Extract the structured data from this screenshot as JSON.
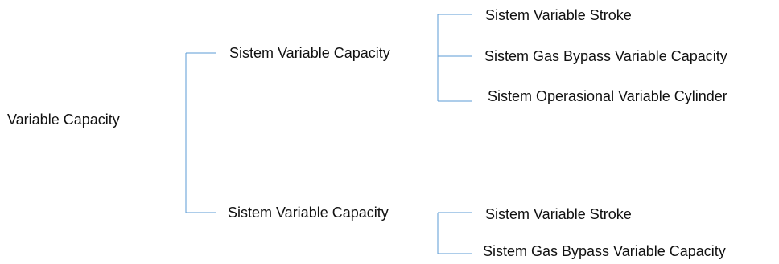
{
  "diagram": {
    "root": {
      "label": "Variable Capacity"
    },
    "branches": [
      {
        "label": "Sistem Variable Capacity",
        "children": [
          {
            "label": "Sistem Variable Stroke"
          },
          {
            "label": "Sistem Gas Bypass Variable Capacity"
          },
          {
            "label": "Sistem Operasional Variable Cylinder"
          }
        ]
      },
      {
        "label": "Sistem Variable Capacity",
        "children": [
          {
            "label": "Sistem Variable Stroke"
          },
          {
            "label": "Sistem Gas Bypass Variable Capacity"
          }
        ]
      }
    ],
    "colors": {
      "connector": "#5b9bd5",
      "text": "#111111",
      "background": "#ffffff"
    }
  }
}
